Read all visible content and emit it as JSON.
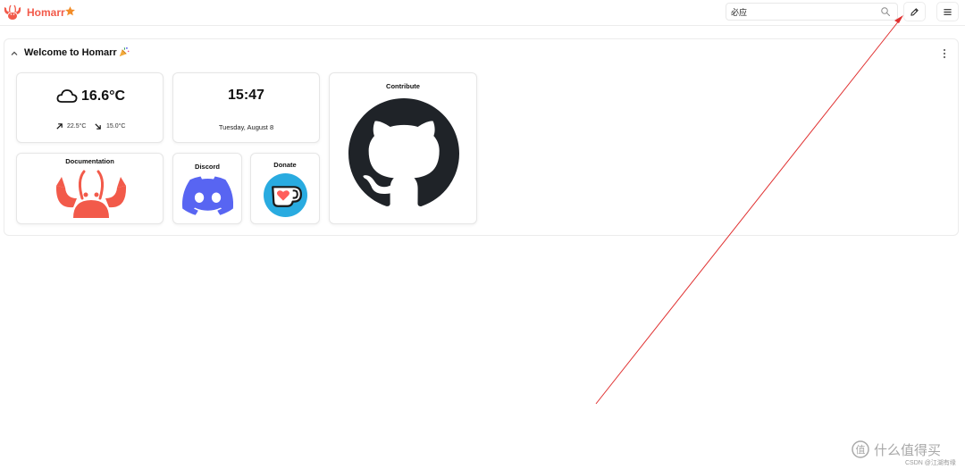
{
  "header": {
    "brand": "Homarr",
    "search_value": "必应"
  },
  "panel": {
    "title": "Welcome to Homarr"
  },
  "weather": {
    "temperature": "16.6°C",
    "max": "22.5°C",
    "min": "15.0°C"
  },
  "clock": {
    "time": "15:47",
    "date": "Tuesday, August 8"
  },
  "tiles": {
    "contribute": "Contribute",
    "documentation": "Documentation",
    "discord": "Discord",
    "donate": "Donate"
  },
  "watermark": {
    "site": "什么值得买",
    "credit": "CSDN @江湖有缘"
  },
  "colors": {
    "brand": "#f25a4a",
    "discord": "#5865f2",
    "kofi": "#29abe0",
    "annotation": "#e03030"
  }
}
